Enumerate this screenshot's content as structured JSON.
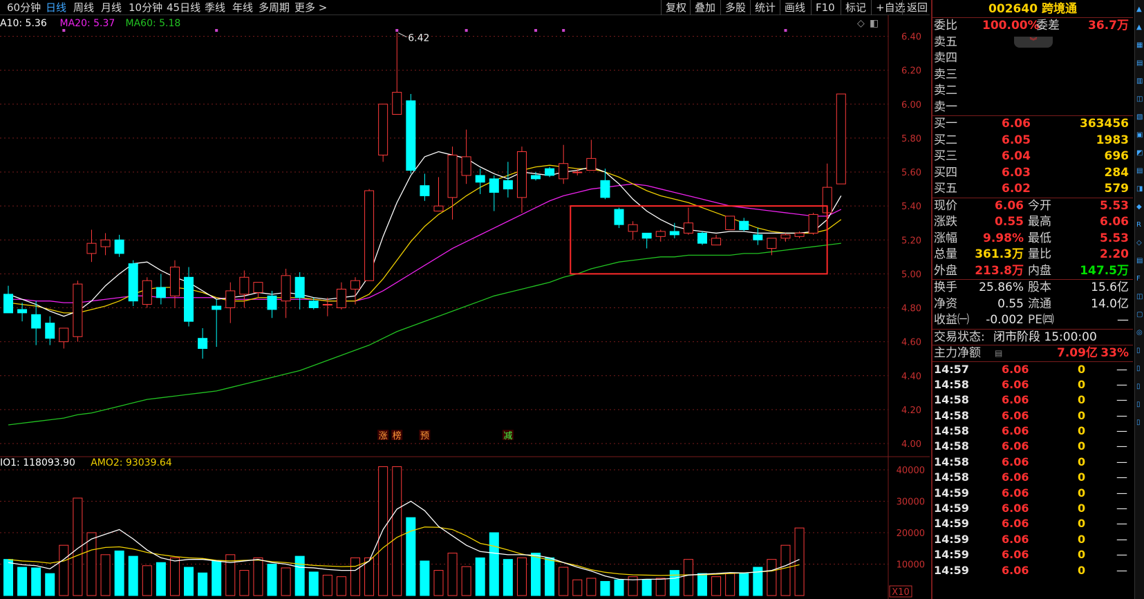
{
  "toolbar": {
    "periods": [
      {
        "label": "60分钟",
        "active": false
      },
      {
        "label": "日线",
        "active": true
      },
      {
        "label": "周线",
        "active": false
      },
      {
        "label": "月线",
        "active": false
      },
      {
        "label": "10分钟",
        "active": false
      },
      {
        "label": "45日线",
        "active": false
      },
      {
        "label": "季线",
        "active": false
      },
      {
        "label": "年线",
        "active": false
      },
      {
        "label": "多周期",
        "active": false
      },
      {
        "label": "更多 >",
        "active": false
      }
    ],
    "actions": [
      "复权",
      "叠加",
      "多股",
      "统计",
      "画线",
      "F10",
      "标记",
      "+自选",
      "返回"
    ]
  },
  "colors": {
    "up": "#ff3b3b",
    "down": "#00ffff",
    "ma10": "#ffffff",
    "ma20": "#f0d000",
    "ma60": "#ee22ee",
    "ma_long": "#22c322",
    "grid": "#7a1c1c",
    "axis_text": "#c83030",
    "box": "#ff2a2a",
    "marker": "#cc44cc"
  },
  "chart_data": [
    {
      "type": "candlestick",
      "legend": [
        {
          "label": "A10: 5.36",
          "color": "#ffffff"
        },
        {
          "label": "MA20: 5.37",
          "color": "#ee22ee"
        },
        {
          "label": "MA60: 5.18",
          "color": "#22c322"
        }
      ],
      "ylim": [
        4.0,
        6.42
      ],
      "yticks": [
        "6.40",
        "6.20",
        "6.00",
        "5.80",
        "5.60",
        "5.40",
        "5.20",
        "5.00",
        "4.80",
        "4.60",
        "4.40",
        "4.20",
        "4.00"
      ],
      "high_label": "6.42",
      "annotations": [
        {
          "text": "涨",
          "bar": 27
        },
        {
          "text": "榜",
          "bar": 28
        },
        {
          "text": "预",
          "bar": 30
        },
        {
          "text": "减",
          "bar": 36
        }
      ],
      "candles": [
        [
          4.88,
          4.77,
          4.93,
          4.77
        ],
        [
          4.79,
          4.77,
          4.83,
          4.72
        ],
        [
          4.76,
          4.68,
          4.84,
          4.58
        ],
        [
          4.71,
          4.62,
          4.75,
          4.58
        ],
        [
          4.6,
          4.68,
          4.66,
          4.56
        ],
        [
          4.63,
          4.94,
          4.96,
          4.6
        ],
        [
          5.12,
          5.18,
          5.26,
          5.07
        ],
        [
          5.16,
          5.2,
          5.24,
          5.11
        ],
        [
          5.2,
          5.12,
          5.23,
          5.1
        ],
        [
          5.06,
          4.84,
          5.08,
          4.81
        ],
        [
          4.82,
          4.96,
          4.98,
          4.8
        ],
        [
          4.92,
          4.86,
          5.0,
          4.82
        ],
        [
          4.87,
          5.04,
          5.08,
          4.8
        ],
        [
          4.98,
          4.72,
          5.04,
          4.69
        ],
        [
          4.62,
          4.56,
          4.68,
          4.5
        ],
        [
          4.81,
          4.79,
          4.85,
          4.57
        ],
        [
          4.8,
          4.9,
          4.95,
          4.71
        ],
        [
          4.88,
          4.98,
          5.02,
          4.8
        ],
        [
          4.89,
          4.95,
          4.95,
          4.86
        ],
        [
          4.87,
          4.79,
          4.9,
          4.74
        ],
        [
          4.84,
          4.99,
          5.03,
          4.74
        ],
        [
          4.98,
          4.86,
          5.01,
          4.79
        ],
        [
          4.84,
          4.8,
          4.86,
          4.79
        ],
        [
          4.82,
          4.82,
          4.86,
          4.75
        ],
        [
          4.8,
          4.91,
          4.95,
          4.79
        ],
        [
          4.91,
          4.96,
          4.98,
          4.82
        ],
        [
          4.96,
          5.49,
          5.5,
          4.96
        ],
        [
          5.7,
          6.0,
          6.0,
          5.66
        ],
        [
          5.94,
          6.07,
          6.42,
          5.98
        ],
        [
          6.02,
          5.61,
          6.06,
          5.59
        ],
        [
          5.52,
          5.46,
          5.59,
          5.43
        ],
        [
          5.37,
          5.4,
          5.57,
          5.39
        ],
        [
          5.45,
          5.7,
          5.75,
          5.32
        ],
        [
          5.58,
          5.69,
          5.85,
          5.53
        ],
        [
          5.58,
          5.54,
          5.62,
          5.47
        ],
        [
          5.56,
          5.48,
          5.58,
          5.37
        ],
        [
          5.55,
          5.5,
          5.66,
          5.45
        ],
        [
          5.45,
          5.72,
          5.75,
          5.36
        ],
        [
          5.58,
          5.56,
          5.6,
          5.55
        ],
        [
          5.62,
          5.58,
          5.63,
          5.57
        ],
        [
          5.56,
          5.65,
          5.76,
          5.53
        ],
        [
          5.6,
          5.6,
          5.62,
          5.58
        ],
        [
          5.61,
          5.68,
          5.79,
          5.62
        ],
        [
          5.55,
          5.45,
          5.62,
          5.44
        ],
        [
          5.38,
          5.29,
          5.39,
          5.27
        ],
        [
          5.25,
          5.29,
          5.31,
          5.2
        ],
        [
          5.24,
          5.21,
          5.24,
          5.15
        ],
        [
          5.22,
          5.25,
          5.26,
          5.19
        ],
        [
          5.25,
          5.23,
          5.3,
          5.21
        ],
        [
          5.24,
          5.3,
          5.39,
          5.23
        ],
        [
          5.24,
          5.18,
          5.25,
          5.17
        ],
        [
          5.17,
          5.21,
          5.23,
          5.17
        ],
        [
          5.26,
          5.34,
          5.34,
          5.26
        ],
        [
          5.31,
          5.26,
          5.33,
          5.25
        ],
        [
          5.23,
          5.2,
          5.27,
          5.17
        ],
        [
          5.15,
          5.21,
          5.21,
          5.11
        ],
        [
          5.21,
          5.23,
          5.24,
          5.19
        ],
        [
          5.22,
          5.24,
          5.25,
          5.21
        ],
        [
          5.24,
          5.35,
          5.36,
          5.23
        ],
        [
          5.36,
          5.51,
          5.65,
          5.33
        ],
        [
          5.53,
          6.06,
          6.06,
          5.53
        ]
      ],
      "ma_white": [
        4.88,
        4.85,
        4.82,
        4.78,
        4.75,
        4.78,
        4.84,
        4.93,
        5.0,
        5.06,
        5.07,
        5.02,
        4.98,
        4.95,
        4.9,
        4.85,
        4.86,
        4.87,
        4.89,
        4.88,
        4.89,
        4.88,
        4.86,
        4.85,
        4.86,
        4.87,
        4.99,
        5.22,
        5.42,
        5.58,
        5.69,
        5.72,
        5.7,
        5.68,
        5.63,
        5.59,
        5.56,
        5.6,
        5.59,
        5.58,
        5.6,
        5.61,
        5.63,
        5.6,
        5.53,
        5.44,
        5.37,
        5.32,
        5.28,
        5.26,
        5.25,
        5.24,
        5.25,
        5.25,
        5.24,
        5.24,
        5.24,
        5.24,
        5.25,
        5.32,
        5.46
      ],
      "ma_yellow": [
        4.83,
        4.82,
        4.81,
        4.79,
        4.77,
        4.77,
        4.79,
        4.81,
        4.84,
        4.88,
        4.91,
        4.92,
        4.92,
        4.91,
        4.89,
        4.86,
        4.84,
        4.84,
        4.86,
        4.86,
        4.86,
        4.86,
        4.85,
        4.84,
        4.84,
        4.84,
        4.88,
        4.97,
        5.08,
        5.19,
        5.28,
        5.35,
        5.4,
        5.46,
        5.51,
        5.55,
        5.58,
        5.61,
        5.63,
        5.64,
        5.63,
        5.62,
        5.62,
        5.6,
        5.57,
        5.53,
        5.49,
        5.46,
        5.44,
        5.42,
        5.39,
        5.36,
        5.33,
        5.3,
        5.27,
        5.25,
        5.24,
        5.24,
        5.24,
        5.26,
        5.32
      ],
      "ma_magenta": [
        4.85,
        4.85,
        4.84,
        4.84,
        4.83,
        4.83,
        4.84,
        4.85,
        4.86,
        4.87,
        4.87,
        4.86,
        4.86,
        4.86,
        4.86,
        4.86,
        4.85,
        4.85,
        4.85,
        4.85,
        4.85,
        4.85,
        4.85,
        4.84,
        4.84,
        4.84,
        4.86,
        4.9,
        4.95,
        5.0,
        5.05,
        5.1,
        5.15,
        5.19,
        5.23,
        5.27,
        5.31,
        5.35,
        5.39,
        5.43,
        5.46,
        5.48,
        5.5,
        5.51,
        5.52,
        5.53,
        5.52,
        5.5,
        5.48,
        5.46,
        5.44,
        5.42,
        5.4,
        5.39,
        5.38,
        5.37,
        5.36,
        5.35,
        5.34,
        5.34,
        5.38
      ],
      "ma_green": [
        4.11,
        4.12,
        4.13,
        4.14,
        4.15,
        4.17,
        4.18,
        4.2,
        4.22,
        4.24,
        4.26,
        4.27,
        4.28,
        4.29,
        4.3,
        4.31,
        4.33,
        4.35,
        4.37,
        4.39,
        4.41,
        4.43,
        4.46,
        4.49,
        4.52,
        4.55,
        4.58,
        4.62,
        4.66,
        4.69,
        4.72,
        4.75,
        4.78,
        4.81,
        4.84,
        4.87,
        4.89,
        4.91,
        4.93,
        4.95,
        4.98,
        5.0,
        5.03,
        5.05,
        5.07,
        5.08,
        5.09,
        5.1,
        5.1,
        5.11,
        5.11,
        5.11,
        5.11,
        5.12,
        5.12,
        5.13,
        5.14,
        5.15,
        5.16,
        5.17,
        5.18
      ],
      "box": {
        "x_start_bar": 41,
        "x_end_bar": 58,
        "y_top": 5.4,
        "y_bottom": 5.0
      },
      "top_markers": [
        4,
        15,
        28,
        33,
        38,
        40,
        56
      ]
    },
    {
      "type": "bar",
      "legend": [
        {
          "label": "IO1: 118093.90",
          "color": "#ffffff"
        },
        {
          "label": "AMO2: 93039.64",
          "color": "#f0d000"
        }
      ],
      "ylim": [
        0,
        42000
      ],
      "yticks": [
        "40000",
        "30000",
        "20000",
        "10000"
      ],
      "unit_label": "X10",
      "values": [
        11500,
        9000,
        8800,
        7000,
        16000,
        31000,
        20000,
        13000,
        14200,
        12500,
        9500,
        10500,
        12000,
        9000,
        7200,
        11000,
        13000,
        8000,
        12000,
        10000,
        8800,
        12500,
        7500,
        6500,
        6000,
        12000,
        12000,
        41000,
        41000,
        24800,
        11000,
        8000,
        13500,
        9200,
        12000,
        20000,
        11500,
        12000,
        13500,
        12000,
        9000,
        5000,
        5500,
        4500,
        5000,
        6000,
        5000,
        5500,
        8000,
        11500,
        7000,
        6000,
        7000,
        7000,
        9000,
        11500,
        16000,
        21500
      ],
      "line_white": [
        10500,
        9800,
        9500,
        8500,
        11500,
        15000,
        18000,
        19500,
        21000,
        18000,
        14500,
        12000,
        11000,
        11500,
        11500,
        11000,
        10500,
        11000,
        11500,
        10500,
        10000,
        9000,
        8800,
        8300,
        8000,
        8000,
        11000,
        21000,
        27500,
        30000,
        27000,
        22000,
        19000,
        16000,
        14000,
        13500,
        13000,
        13000,
        12800,
        12000,
        10500,
        9000,
        7800,
        6200,
        5200,
        5000,
        5200,
        5200,
        5500,
        6500,
        6800,
        7000,
        7300,
        7200,
        7500,
        8000,
        9500,
        11500
      ],
      "line_yellow": [
        11500,
        11000,
        10800,
        10300,
        11000,
        12800,
        14500,
        15300,
        15500,
        14800,
        13700,
        13000,
        12400,
        12000,
        11800,
        11200,
        11000,
        11200,
        11300,
        10800,
        10500,
        10000,
        9600,
        9400,
        9200,
        9300,
        11000,
        15200,
        18500,
        20500,
        21800,
        21700,
        21000,
        19000,
        16600,
        15700,
        14500,
        13200,
        12300,
        11300,
        10500,
        9500,
        8200,
        7400,
        6900,
        6600,
        6500,
        6400,
        6500,
        6600,
        6600,
        6800,
        7000,
        7200,
        7500,
        7800,
        8800,
        9800
      ]
    }
  ],
  "quote": {
    "stock_code": "002640",
    "stock_name": "跨境通",
    "weibi_label": "委比",
    "weibi_value": "100.00%",
    "weicha_label": "委差",
    "weicha_value": "36.7万",
    "sell_levels": [
      {
        "label": "卖五"
      },
      {
        "label": "卖四"
      },
      {
        "label": "卖三"
      },
      {
        "label": "卖二"
      },
      {
        "label": "卖一"
      }
    ],
    "buy_levels": [
      {
        "label": "买一",
        "price": "6.06",
        "volume": "363456"
      },
      {
        "label": "买二",
        "price": "6.05",
        "volume": "1983"
      },
      {
        "label": "买三",
        "price": "6.04",
        "volume": "696"
      },
      {
        "label": "买四",
        "price": "6.03",
        "volume": "284"
      },
      {
        "label": "买五",
        "price": "6.02",
        "volume": "579"
      }
    ],
    "stats": [
      {
        "l1": "现价",
        "v1": "6.06",
        "l2": "今开",
        "v2": "5.53",
        "c1": "red",
        "c2": "red"
      },
      {
        "l1": "涨跌",
        "v1": "0.55",
        "l2": "最高",
        "v2": "6.06",
        "c1": "red",
        "c2": "red"
      },
      {
        "l1": "涨幅",
        "v1": "9.98%",
        "l2": "最低",
        "v2": "5.53",
        "c1": "red",
        "c2": "red"
      },
      {
        "l1": "总量",
        "v1": "361.3万",
        "l2": "量比",
        "v2": "2.20",
        "c1": "yel",
        "c2": "red"
      },
      {
        "l1": "外盘",
        "v1": "213.8万",
        "l2": "内盘",
        "v2": "147.5万",
        "c1": "red",
        "c2": "grn"
      }
    ],
    "stats2": [
      {
        "l1": "换手",
        "v1": "25.86%",
        "l2": "股本",
        "v2": "15.6亿"
      },
      {
        "l1": "净资",
        "v1": "0.55",
        "l2": "流通",
        "v2": "14.0亿"
      },
      {
        "l1": "收益㈠",
        "v1": "-0.002",
        "l2": "PE㈣",
        "v2": "—"
      }
    ],
    "trade_status_label": "交易状态:",
    "trade_status_value": "闭市阶段 15:00:00",
    "main_net_label": "主力净额",
    "main_net_value": "7.09亿",
    "main_net_pct": "33%",
    "ticks": [
      {
        "time": "14:57",
        "price": "6.06",
        "vol": "0",
        "dir": "—"
      },
      {
        "time": "14:58",
        "price": "6.06",
        "vol": "0",
        "dir": "—"
      },
      {
        "time": "14:58",
        "price": "6.06",
        "vol": "0",
        "dir": "—"
      },
      {
        "time": "14:58",
        "price": "6.06",
        "vol": "0",
        "dir": "—"
      },
      {
        "time": "14:58",
        "price": "6.06",
        "vol": "0",
        "dir": "—"
      },
      {
        "time": "14:58",
        "price": "6.06",
        "vol": "0",
        "dir": "—"
      },
      {
        "time": "14:58",
        "price": "6.06",
        "vol": "0",
        "dir": "—"
      },
      {
        "time": "14:58",
        "price": "6.06",
        "vol": "0",
        "dir": "—"
      },
      {
        "time": "14:59",
        "price": "6.06",
        "vol": "0",
        "dir": "—"
      },
      {
        "time": "14:59",
        "price": "6.06",
        "vol": "0",
        "dir": "—"
      },
      {
        "time": "14:59",
        "price": "6.06",
        "vol": "0",
        "dir": "—"
      },
      {
        "time": "14:59",
        "price": "6.06",
        "vol": "0",
        "dir": "—"
      },
      {
        "time": "14:59",
        "price": "6.06",
        "vol": "0",
        "dir": "—"
      },
      {
        "time": "14:59",
        "price": "6.06",
        "vol": "0",
        "dir": "—"
      }
    ]
  }
}
